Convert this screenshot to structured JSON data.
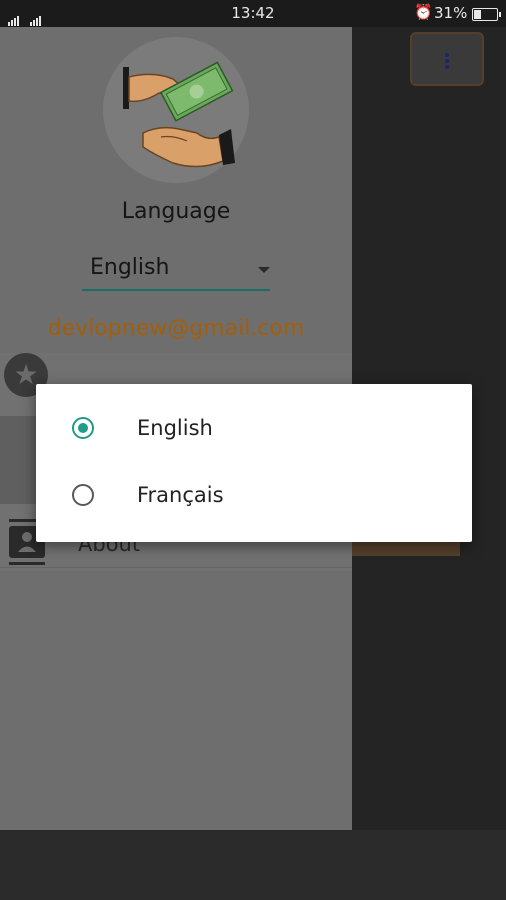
{
  "status_bar": {
    "time": "13:42",
    "battery": "31%",
    "signal_icon": "signal-icon",
    "alarm_icon": "alarm-icon"
  },
  "drawer": {
    "logo_icon": "money-handover-icon",
    "language_label": "Language",
    "language_selected": "English",
    "email": "devlopnew@gmail.com",
    "items": [
      {
        "icon": "star-icon",
        "label": ""
      },
      {
        "icon": "share-icon",
        "label": ""
      },
      {
        "icon": "contact-card-icon",
        "label": "About"
      }
    ]
  },
  "toolbar": {
    "overflow_icon": "more-vert-icon"
  },
  "dialog": {
    "options": [
      {
        "label": "English",
        "selected": true
      },
      {
        "label": "Français",
        "selected": false
      }
    ]
  },
  "colors": {
    "accent": "#1f9b87",
    "email": "#a45e08",
    "spinner_underline": "#1b6f62"
  }
}
